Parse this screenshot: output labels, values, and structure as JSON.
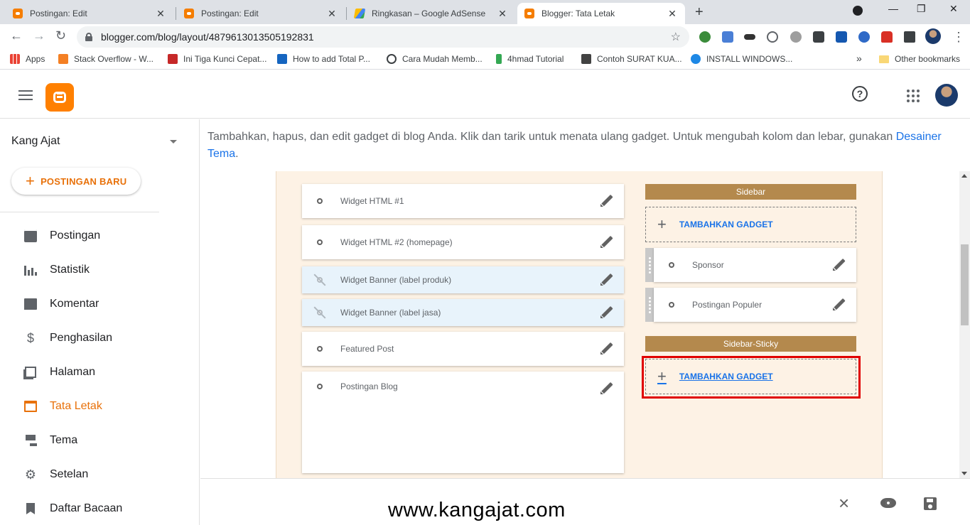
{
  "browser": {
    "tabs": [
      {
        "title": "Postingan: Edit",
        "icon": "blogger-icon",
        "active": false
      },
      {
        "title": "Postingan: Edit",
        "icon": "blogger-icon",
        "active": false
      },
      {
        "title": "Ringkasan – Google AdSense",
        "icon": "adsense-icon",
        "active": false
      },
      {
        "title": "Blogger: Tata Letak",
        "icon": "blogger-icon",
        "active": true
      }
    ],
    "url": "blogger.com/blog/layout/4879613013505192831",
    "bookmarks": [
      {
        "label": "Apps",
        "icon": "apps-icon"
      },
      {
        "label": "Stack Overflow - W...",
        "icon": "stackoverflow-icon"
      },
      {
        "label": "Ini Tiga Kunci Cepat...",
        "icon": "r-icon"
      },
      {
        "label": "How to add Total P...",
        "icon": "tech-icon"
      },
      {
        "label": "Cara Mudah Memb...",
        "icon": "google-icon"
      },
      {
        "label": "4hmad Tutorial",
        "icon": "tutorial-icon"
      },
      {
        "label": "Contoh SURAT KUA...",
        "icon": "doc-icon"
      },
      {
        "label": "INSTALL WINDOWS...",
        "icon": "globe-icon"
      }
    ],
    "bookmarks_more": "»",
    "other_bookmarks": "Other bookmarks"
  },
  "blogger": {
    "blog_name": "Kang Ajat",
    "new_post_label": "POSTINGAN BARU",
    "nav": [
      {
        "label": "Postingan",
        "icon": "posts-icon",
        "active": false
      },
      {
        "label": "Statistik",
        "icon": "stats-icon",
        "active": false
      },
      {
        "label": "Komentar",
        "icon": "comment-icon",
        "active": false
      },
      {
        "label": "Penghasilan",
        "icon": "dollar-icon",
        "active": false
      },
      {
        "label": "Halaman",
        "icon": "pages-icon",
        "active": false
      },
      {
        "label": "Tata Letak",
        "icon": "layout-icon",
        "active": true
      },
      {
        "label": "Tema",
        "icon": "theme-icon",
        "active": false
      },
      {
        "label": "Setelan",
        "icon": "settings-icon",
        "active": false
      },
      {
        "label": "Daftar Bacaan",
        "icon": "bookmark-icon",
        "active": false
      }
    ],
    "accent_color": "#e8710a"
  },
  "layout": {
    "intro_text": "Tambahkan, hapus, dan edit gadget di blog Anda. Klik dan tarik untuk menata ulang gadget. Untuk mengubah kolom dan lebar, gunakan ",
    "intro_link": "Desainer Tema",
    "intro_end": ".",
    "main_gadgets": [
      {
        "title": "Widget HTML #1",
        "visible": true
      },
      {
        "title": "Widget HTML #2 (homepage)",
        "visible": true
      },
      {
        "title": "Widget Banner (label produk)",
        "visible": false
      },
      {
        "title": "Widget Banner (label jasa)",
        "visible": false
      },
      {
        "title": "Featured Post",
        "visible": true
      },
      {
        "title": "Postingan Blog",
        "visible": true
      }
    ],
    "sidebar_title": "Sidebar",
    "sidebar_add": "TAMBAHKAN GADGET",
    "sidebar_gadgets": [
      {
        "title": "Sponsor"
      },
      {
        "title": "Postingan Populer"
      }
    ],
    "sticky_title": "Sidebar-Sticky",
    "sticky_add": "TAMBAHKAN GADGET",
    "section_color": "#b4894d"
  },
  "footer": {
    "watermark": "www.kangajat.com"
  }
}
